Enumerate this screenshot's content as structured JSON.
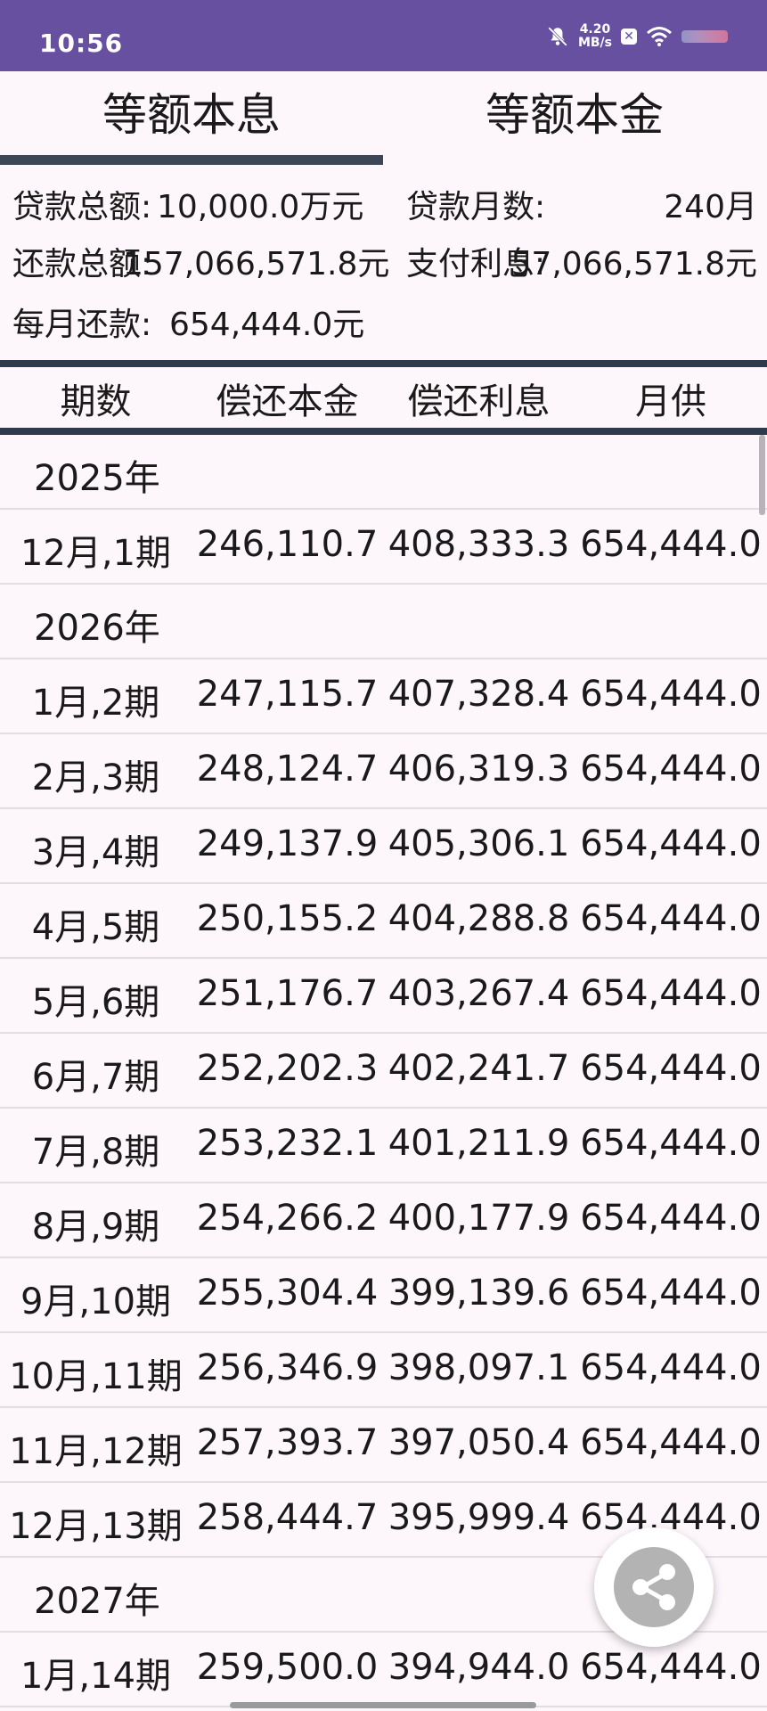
{
  "status_bar": {
    "time": "10:56",
    "net_speed_value": "4.20",
    "net_speed_unit": "MB/s",
    "x_badge": "✕"
  },
  "tabs": [
    {
      "label": "等额本息",
      "selected": true
    },
    {
      "label": "等额本金",
      "selected": false
    }
  ],
  "summary": {
    "loan_total_label": "贷款总额:",
    "loan_total_value": "10,000.0万元",
    "loan_months_label": "贷款月数:",
    "loan_months_value": "240月",
    "repay_total_label": "还款总额:",
    "repay_total_value": "157,066,571.8元",
    "interest_label": "支付利息:",
    "interest_value": "57,066,571.8元",
    "monthly_label": "每月还款:",
    "monthly_value": "654,444.0元"
  },
  "table": {
    "headers": [
      "期数",
      "偿还本金",
      "偿还利息",
      "月供"
    ],
    "rows": [
      {
        "type": "year",
        "label": "2025年"
      },
      {
        "type": "data",
        "cells": [
          "12月,1期",
          "246,110.7",
          "408,333.3",
          "654,444.0"
        ]
      },
      {
        "type": "year",
        "label": "2026年"
      },
      {
        "type": "data",
        "cells": [
          "1月,2期",
          "247,115.7",
          "407,328.4",
          "654,444.0"
        ]
      },
      {
        "type": "data",
        "cells": [
          "2月,3期",
          "248,124.7",
          "406,319.3",
          "654,444.0"
        ]
      },
      {
        "type": "data",
        "cells": [
          "3月,4期",
          "249,137.9",
          "405,306.1",
          "654,444.0"
        ]
      },
      {
        "type": "data",
        "cells": [
          "4月,5期",
          "250,155.2",
          "404,288.8",
          "654,444.0"
        ]
      },
      {
        "type": "data",
        "cells": [
          "5月,6期",
          "251,176.7",
          "403,267.4",
          "654,444.0"
        ]
      },
      {
        "type": "data",
        "cells": [
          "6月,7期",
          "252,202.3",
          "402,241.7",
          "654,444.0"
        ]
      },
      {
        "type": "data",
        "cells": [
          "7月,8期",
          "253,232.1",
          "401,211.9",
          "654,444.0"
        ]
      },
      {
        "type": "data",
        "cells": [
          "8月,9期",
          "254,266.2",
          "400,177.9",
          "654,444.0"
        ]
      },
      {
        "type": "data",
        "cells": [
          "9月,10期",
          "255,304.4",
          "399,139.6",
          "654,444.0"
        ]
      },
      {
        "type": "data",
        "cells": [
          "10月,11期",
          "256,346.9",
          "398,097.1",
          "654,444.0"
        ]
      },
      {
        "type": "data",
        "cells": [
          "11月,12期",
          "257,393.7",
          "397,050.4",
          "654,444.0"
        ]
      },
      {
        "type": "data",
        "cells": [
          "12月,13期",
          "258,444.7",
          "395,999.4",
          "654,444.0"
        ]
      },
      {
        "type": "year",
        "label": "2027年"
      },
      {
        "type": "data",
        "cells": [
          "1月,14期",
          "259,500.0",
          "394,944.0",
          "654,444.0"
        ]
      }
    ]
  },
  "fab": {
    "icon": "share-icon"
  }
}
